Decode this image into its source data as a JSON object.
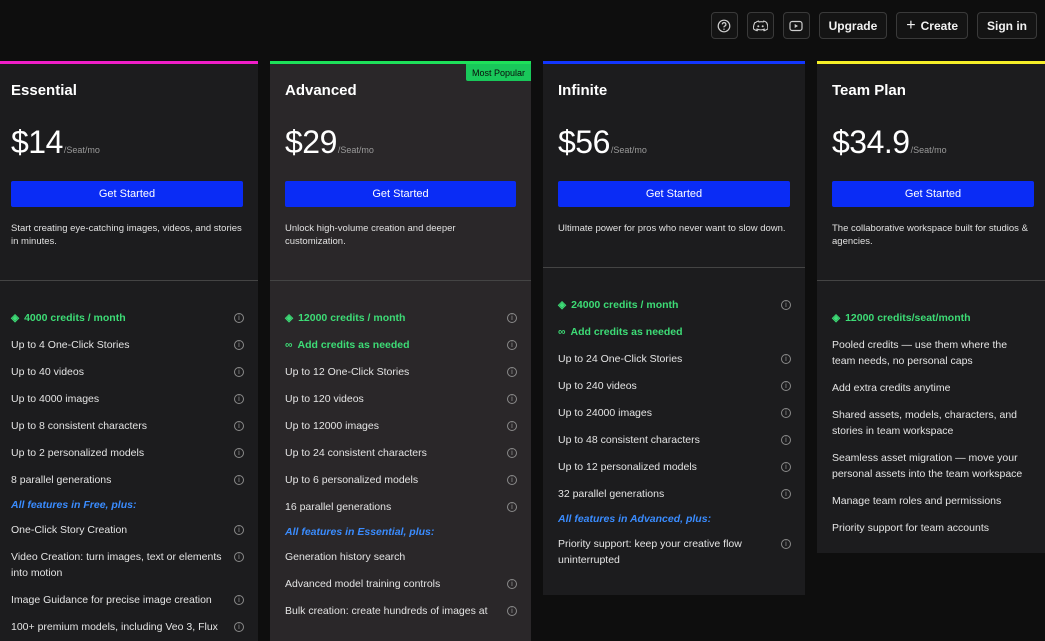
{
  "topbar": {
    "help_icon": "question-circle-icon",
    "discord_icon": "discord-icon",
    "youtube_icon": "youtube-icon",
    "upgrade_label": "Upgrade",
    "create_label": "Create",
    "signin_label": "Sign in"
  },
  "colors": {
    "essential": "#f01ec8",
    "advanced": "#1ee05a",
    "infinite": "#1236ff",
    "team": "#f5ee28",
    "cta": "#0a2cf5",
    "credit_green": "#3ddc76",
    "section_blue": "#3a8cff"
  },
  "plans": [
    {
      "name": "Essential",
      "price": "$14",
      "per": "/Seat/mo",
      "cta": "Get Started",
      "desc": "Start creating eye-catching images, videos, and stories in minutes.",
      "badge": "",
      "features_a": [
        {
          "text": "4000 credits / month",
          "kind": "credit",
          "lead": "◈"
        },
        {
          "text": "Up to 4 One-Click Stories"
        },
        {
          "text": "Up to 40 videos"
        },
        {
          "text": "Up to 4000 images"
        },
        {
          "text": "Up to 8 consistent characters"
        },
        {
          "text": "Up to 2 personalized models"
        },
        {
          "text": "8 parallel generations"
        }
      ],
      "section": "All features in Free, plus:",
      "features_b": [
        {
          "text": "One-Click Story Creation"
        },
        {
          "text": "Video Creation: turn images, text or elements into motion"
        },
        {
          "text": "Image Guidance for precise image creation"
        },
        {
          "text": "100+ premium models, including Veo 3, Flux"
        }
      ]
    },
    {
      "name": "Advanced",
      "price": "$29",
      "per": "/Seat/mo",
      "cta": "Get Started",
      "desc": "Unlock high-volume creation and deeper customization.",
      "badge": "Most Popular",
      "features_a": [
        {
          "text": "12000 credits / month",
          "kind": "credit",
          "lead": "◈"
        },
        {
          "text": "Add credits as needed",
          "kind": "credit",
          "lead": "∞"
        },
        {
          "text": "Up to 12 One-Click Stories"
        },
        {
          "text": "Up to 120 videos"
        },
        {
          "text": "Up to 12000 images"
        },
        {
          "text": "Up to 24 consistent characters"
        },
        {
          "text": "Up to 6 personalized models"
        },
        {
          "text": "16 parallel generations"
        }
      ],
      "section": "All features in Essential, plus:",
      "features_b": [
        {
          "text": "Generation history search",
          "noinfo": true
        },
        {
          "text": "Advanced model training controls"
        },
        {
          "text": "Bulk creation: create hundreds of images at"
        }
      ]
    },
    {
      "name": "Infinite",
      "price": "$56",
      "per": "/Seat/mo",
      "cta": "Get Started",
      "desc": "Ultimate power for pros who never want to slow down.",
      "badge": "",
      "features_a": [
        {
          "text": "24000 credits / month",
          "kind": "credit",
          "lead": "◈"
        },
        {
          "text": "Add credits as needed",
          "kind": "credit",
          "lead": "∞",
          "noinfo": true
        },
        {
          "text": "Up to 24 One-Click Stories"
        },
        {
          "text": "Up to 240 videos"
        },
        {
          "text": "Up to 24000 images"
        },
        {
          "text": "Up to 48 consistent characters"
        },
        {
          "text": "Up to 12 personalized models"
        },
        {
          "text": "32 parallel generations"
        }
      ],
      "section": "All features in Advanced, plus:",
      "features_b": [
        {
          "text": "Priority support: keep your creative flow uninterrupted"
        }
      ]
    },
    {
      "name": "Team Plan",
      "price": "$34.9",
      "per": "/Seat/mo",
      "cta": "Get Started",
      "desc": "The collaborative workspace built for studios & agencies.",
      "badge": "",
      "features_a": [
        {
          "text": "12000 credits/seat/month",
          "kind": "credit",
          "lead": "◈",
          "noinfo": true
        },
        {
          "text": "Pooled credits — use them where the team needs, no personal caps",
          "noinfo": true
        },
        {
          "text": "Add extra credits anytime",
          "noinfo": true
        },
        {
          "text": "Shared assets, models, characters, and stories in team workspace",
          "noinfo": true
        },
        {
          "text": "Seamless asset migration — move your personal assets into the team workspace",
          "noinfo": true
        },
        {
          "text": "Manage team roles and permissions",
          "noinfo": true
        },
        {
          "text": "Priority support for team accounts",
          "noinfo": true
        }
      ],
      "section": "",
      "features_b": []
    }
  ]
}
